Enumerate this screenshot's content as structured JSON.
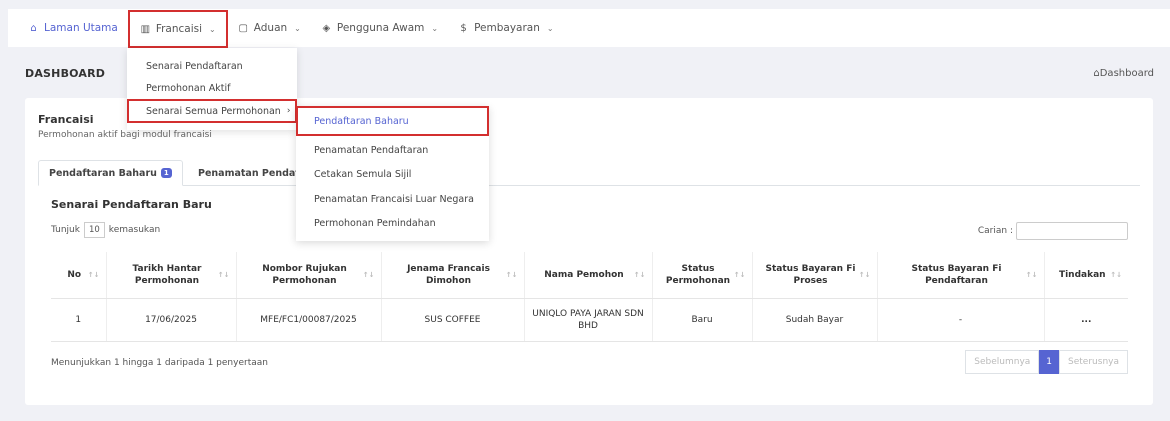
{
  "nav": {
    "items": [
      {
        "label": "Laman Utama",
        "icon": "home-icon"
      },
      {
        "label": "Francaisi",
        "icon": "book-icon"
      },
      {
        "label": "Aduan",
        "icon": "message-icon"
      },
      {
        "label": "Pengguna Awam",
        "icon": "shield-icon"
      },
      {
        "label": "Pembayaran",
        "icon": "dollar-icon"
      }
    ]
  },
  "page": {
    "title": "DASHBOARD",
    "breadcrumb": "Dashboard"
  },
  "card": {
    "title": "Francaisi",
    "subtitle": "Permohonan aktif bagi modul francaisi"
  },
  "tabs": [
    {
      "label": "Pendaftaran Baharu",
      "badge": "1"
    },
    {
      "label": "Penamatan Pendaftaran"
    }
  ],
  "section_title": "Senarai Pendaftaran Baru",
  "length": {
    "prefix": "Tunjuk",
    "value": "10",
    "suffix": "kemasukan"
  },
  "search_label": "Carian :",
  "table": {
    "headers": [
      "No",
      "Tarikh Hantar Permohonan",
      "Nombor Rujukan Permohonan",
      "Jenama Francais Dimohon",
      "Nama Pemohon",
      "Status Permohonan",
      "Status Bayaran Fi Proses",
      "Status Bayaran Fi Pendaftaran",
      "Tindakan"
    ],
    "rows": [
      [
        "1",
        "17/06/2025",
        "MFE/FC1/00087/2025",
        "SUS COFFEE",
        "UNIQLO PAYA JARAN SDN BHD",
        "Baru",
        "Sudah Bayar",
        "-",
        "..."
      ]
    ]
  },
  "info": "Menunjukkan 1 hingga 1 daripada 1 penyertaan",
  "pager": {
    "prev": "Sebelumnya",
    "current": "1",
    "next": "Seterusnya"
  },
  "dropdown_francaisi": {
    "items": [
      "Senarai Pendaftaran",
      "Permohonan Aktif",
      "Senarai Semua Permohonan"
    ]
  },
  "submenu": {
    "items": [
      "Pendaftaran Baharu",
      "Penamatan Pendaftaran",
      "Cetakan Semula Sijil",
      "Penamatan Francaisi Luar Negara",
      "Permohonan Pemindahan"
    ]
  },
  "colors": {
    "accent": "#5664d2",
    "highlight_border": "#d32f2f"
  }
}
